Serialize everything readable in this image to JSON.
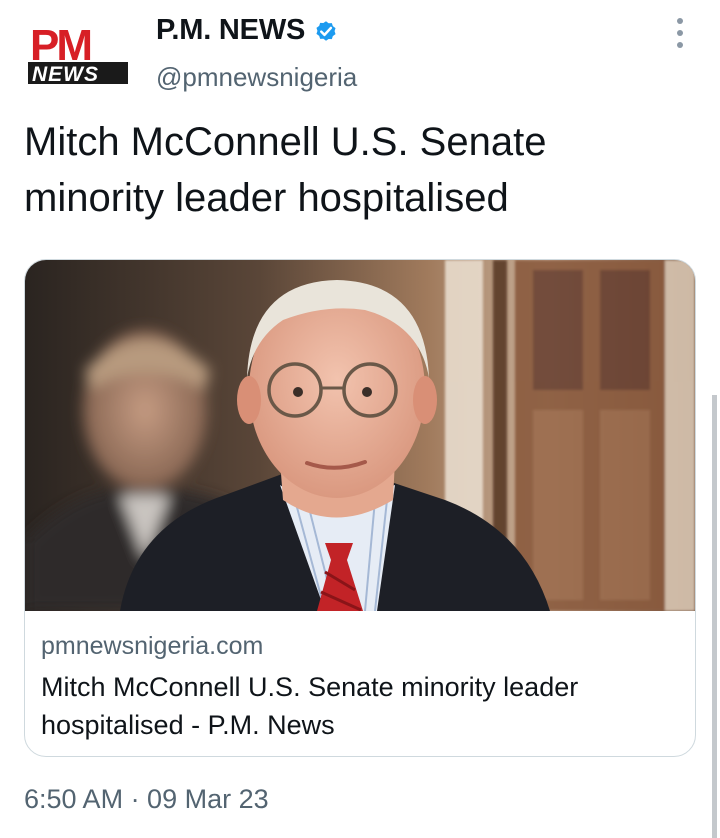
{
  "profile": {
    "logo_text_top": "PM",
    "logo_text_bottom": "NEWS",
    "display_name": "P.M. NEWS",
    "handle": "@pmnewsnigeria",
    "verified": true
  },
  "tweet": {
    "text": "Mitch McConnell U.S. Senate minority leader hospitalised",
    "timestamp": "6:50 AM · 09 Mar 23"
  },
  "card": {
    "domain": "pmnewsnigeria.com",
    "title": "Mitch McConnell U.S. Senate minority leader hospitalised - P.M. News"
  },
  "icons": {
    "verified": "verified-badge-icon",
    "more": "more-options-icon"
  },
  "colors": {
    "brand_red": "#d71f26",
    "verified_blue": "#1d9bf0",
    "secondary_text": "#536471",
    "border": "#cfd9de"
  }
}
